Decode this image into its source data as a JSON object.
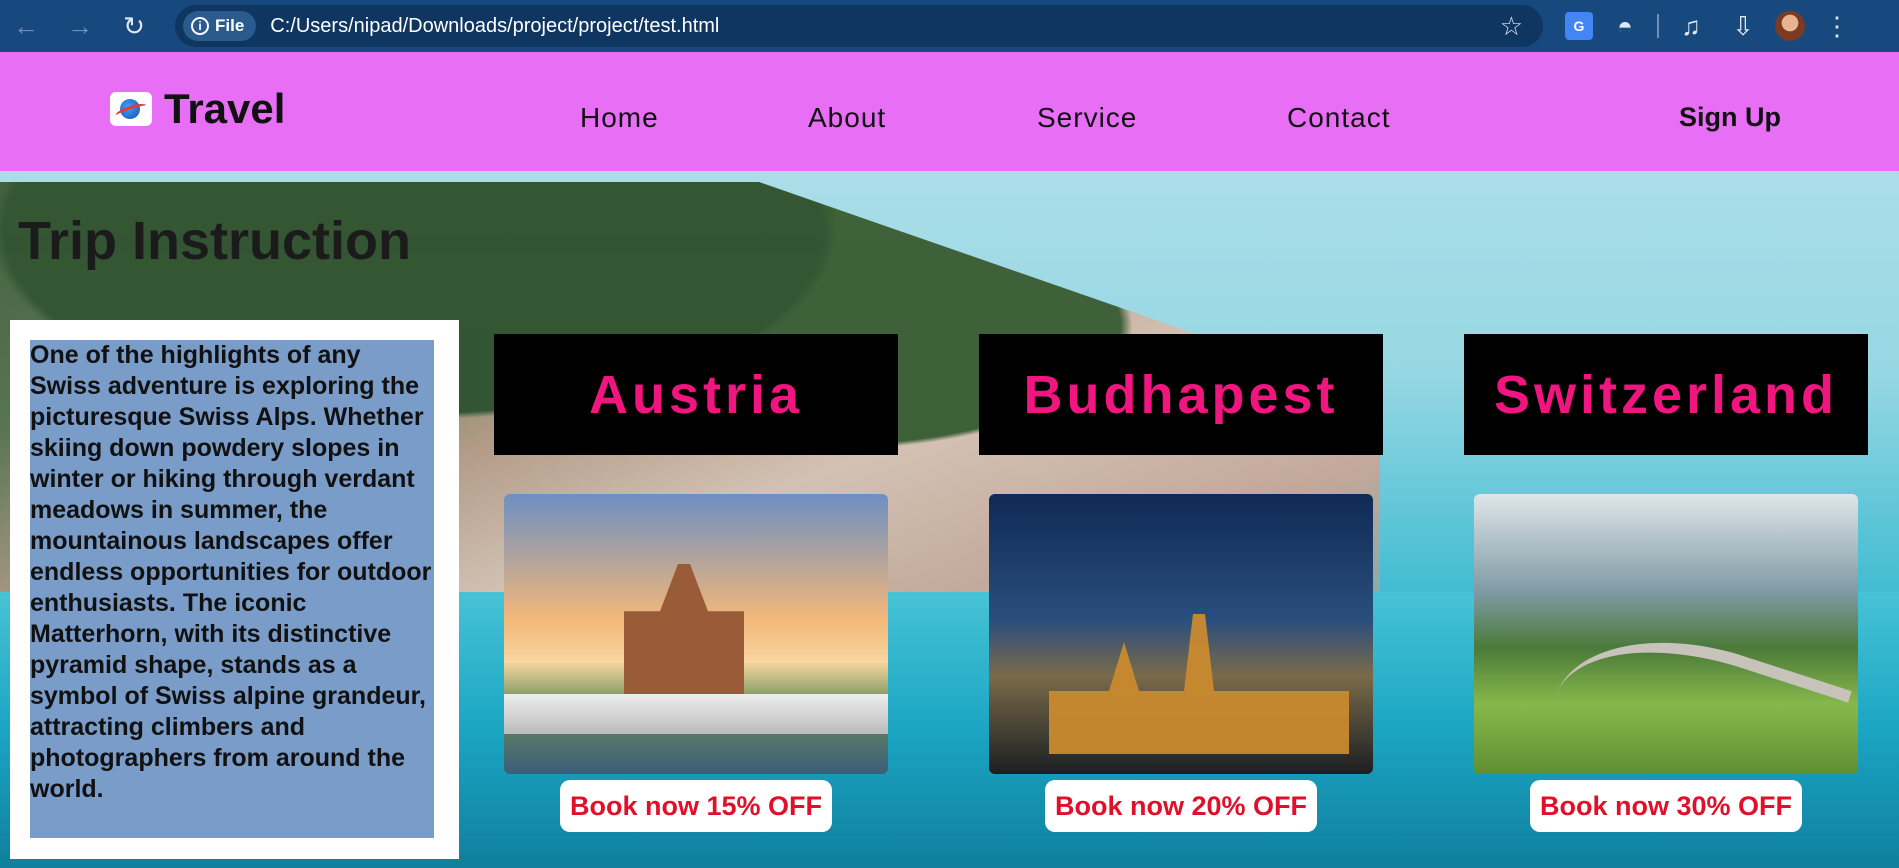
{
  "browser": {
    "back_icon": "arrow-left-icon",
    "forward_icon": "arrow-right-icon",
    "reload_icon": "reload-icon",
    "file_chip_label": "File",
    "url": "C:/Users/nipad/Downloads/project/project/test.html"
  },
  "header": {
    "logo_text": "Travel",
    "nav": [
      "Home",
      "About",
      "Service",
      "Contact"
    ],
    "signup": "Sign Up"
  },
  "main": {
    "title": "Trip Instruction",
    "paragraph": "One of the highlights of any Swiss adventure is exploring the picturesque Swiss Alps. Whether skiing down powdery slopes in winter or hiking through verdant meadows in summer, the mountainous landscapes offer endless opportunities for outdoor enthusiasts. The iconic Matterhorn, with its distinctive pyramid shape, stands as a symbol of Swiss alpine grandeur, attracting climbers and photographers from around the world.",
    "cards": [
      {
        "title": "Austria",
        "book": "Book now 15% OFF"
      },
      {
        "title": "Budhapest",
        "book": "Book now 20% OFF"
      },
      {
        "title": "Switzerland",
        "book": "Book now 30% OFF"
      }
    ]
  },
  "colors": {
    "header_bg": "#e86ef6",
    "card_title_text": "#f0157f",
    "book_text": "#e0102a",
    "paragraph_bg": "#7a9cc8"
  }
}
